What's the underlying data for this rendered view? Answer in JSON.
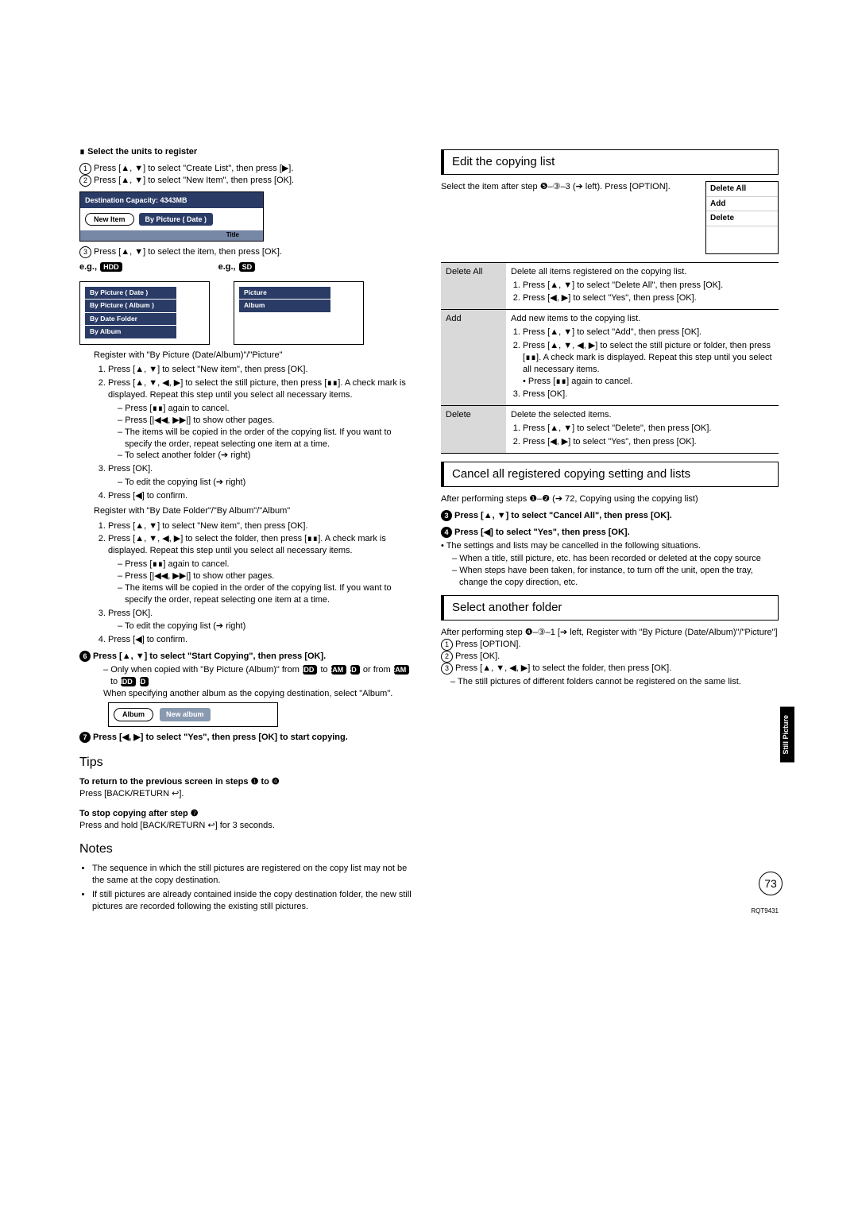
{
  "left": {
    "select_units": "Select the units to register",
    "l1": "Press [▲, ▼] to select \"Create List\", then press [▶].",
    "l2": "Press [▲, ▼] to select \"New Item\", then press [OK].",
    "dest_cap": "Destination Capacity: 4343MB",
    "new_item": "New Item",
    "by_pic_date_btn": "By Picture ( Date )",
    "title_mini": "Title",
    "l3": "Press [▲, ▼] to select the item, then press [OK].",
    "eg_hdd": "e.g.,",
    "eg_sd": "e.g.,",
    "hdd": "HDD",
    "sd": "SD",
    "menu_hdd": {
      "a": "By Picture ( Date )",
      "b": "By Picture ( Album )",
      "c": "By Date Folder",
      "d": "By Album"
    },
    "menu_sd": {
      "a": "Picture",
      "b": "Album"
    },
    "reg1": "Register with \"By Picture (Date/Album)\"/\"Picture\"",
    "reg1_1": "Press [▲, ▼] to select \"New item\", then press [OK].",
    "reg1_2": "Press [▲, ▼, ◀, ▶] to select the still picture, then press [∎∎]. A check mark is displayed. Repeat this step until you select all necessary items.",
    "reg1_2a": "Press [∎∎] again to cancel.",
    "reg1_2b": "Press [|◀◀, ▶▶|] to show other pages.",
    "reg1_2c": "The items will be copied in the order of the copying list. If you want to specify the order, repeat selecting one item at a time.",
    "reg1_2d": "To select another folder (➔ right)",
    "reg1_3": "Press [OK].",
    "reg1_3a": "To edit the copying list (➔ right)",
    "reg1_4": "Press [◀] to confirm.",
    "reg2": "Register with \"By Date Folder\"/\"By Album\"/\"Album\"",
    "reg2_1": "Press [▲, ▼] to select \"New item\", then press [OK].",
    "reg2_2": "Press [▲, ▼, ◀, ▶] to select the folder, then press [∎∎]. A check mark is displayed. Repeat this step until you select all necessary items.",
    "reg2_2a": "Press [∎∎] again to cancel.",
    "reg2_2b": "Press [|◀◀, ▶▶|] to show other pages.",
    "reg2_2c": "The items will be copied in the order of the copying list. If you want to specify the order, repeat selecting one item at a time.",
    "reg2_3": "Press [OK].",
    "reg2_3a": "To edit the copying list (➔ right)",
    "reg2_4": "Press [◀] to confirm.",
    "step6": "Press [▲, ▼] to select \"Start Copying\", then press [OK].",
    "step6_note_pre": "Only when copied with \"By Picture (Album)\" from ",
    "step6_note_mid": " to ",
    "step6_note_or": " or from ",
    "step6_note2": "When specifying another album as the copying destination, select \"Album\".",
    "album": "Album",
    "new_album": "New album",
    "step7": "Press [◀, ▶] to select \"Yes\", then press [OK] to start copying.",
    "tips": "Tips",
    "tips1h": "To return to the previous screen in steps ❶ to ❹",
    "tips1b": "Press [BACK/RETURN ↩].",
    "tips2h": "To stop copying after step ❼",
    "tips2b": "Press and hold [BACK/RETURN ↩] for 3 seconds.",
    "notes": "Notes",
    "note1": "The sequence in which the still pictures are registered on the copy list may not be the same at the copy destination.",
    "note2": "If still pictures are already contained inside the copy destination folder, the new still pictures are recorded following the existing still pictures."
  },
  "right": {
    "edit_title": "Edit the copying list",
    "edit_lead": "Select the item after step ❺–③–3 (➔ left). Press [OPTION].",
    "menu": {
      "a": "Delete All",
      "b": "Add",
      "c": "Delete"
    },
    "rowDA_h": "Delete All",
    "rowDA_b": "Delete all items registered on the copying list.",
    "rowDA_1": "Press [▲, ▼] to select \"Delete All\", then press [OK].",
    "rowDA_2": "Press [◀, ▶] to select \"Yes\", then press [OK].",
    "rowA_h": "Add",
    "rowA_b": "Add new items to the copying list.",
    "rowA_1": "Press [▲, ▼] to select \"Add\", then press [OK].",
    "rowA_2": "Press [▲, ▼, ◀, ▶] to select the still picture or folder, then press [∎∎]. A check mark is displayed. Repeat this step until you select all necessary items.",
    "rowA_2b": "• Press [∎∎] again to cancel.",
    "rowA_3": "Press [OK].",
    "rowD_h": "Delete",
    "rowD_b": "Delete the selected items.",
    "rowD_1": "Press [▲, ▼] to select \"Delete\", then press [OK].",
    "rowD_2": "Press [◀, ▶] to select \"Yes\", then press [OK].",
    "cancel_title": "Cancel all registered copying setting and lists",
    "cancel_lead": "After performing steps ❶–❷ (➔ 72, Copying using the copying list)",
    "cancel_s3": "Press [▲, ▼] to select \"Cancel All\", then press [OK].",
    "cancel_s4": "Press [◀] to select \"Yes\", then press [OK].",
    "cancel_note": "• The settings and lists may be cancelled in the following situations.",
    "cancel_n1": "When a title, still picture, etc. has been recorded or deleted at the copy source",
    "cancel_n2": "When steps have been taken, for instance, to turn off the unit, open the tray, change the copy direction, etc.",
    "sel_title": "Select another folder",
    "sel_lead": "After performing step ❹–③–1 [➔ left, Register with \"By Picture (Date/Album)\"/\"Picture\"]",
    "sel_1": "Press [OPTION].",
    "sel_2": "Press [OK].",
    "sel_3": "Press [▲, ▼, ◀, ▶] to select the folder, then press [OK].",
    "sel_3a": "The still pictures of different folders cannot be registered on the same list.",
    "side_tab": "Still Picture",
    "page": "73",
    "docid": "RQT9431"
  },
  "labels": {
    "ram": "RAM",
    "sd": "SD",
    "hdd": "HDD"
  }
}
